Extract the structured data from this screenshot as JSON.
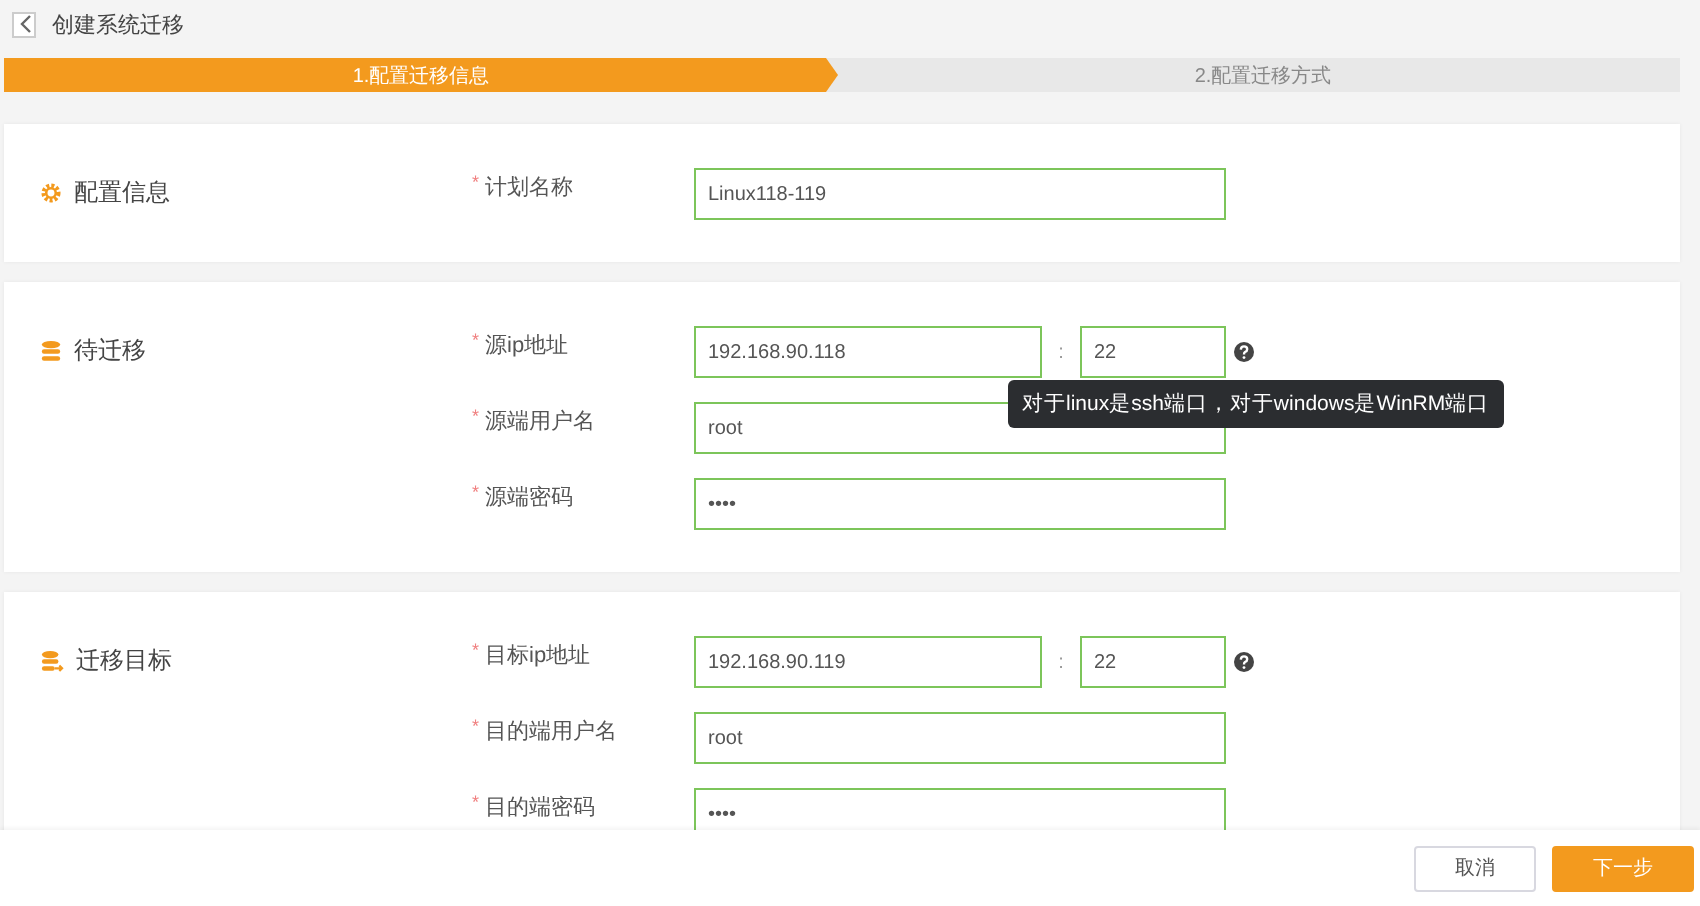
{
  "header": {
    "title": "创建系统迁移"
  },
  "steps": [
    {
      "label": "1.配置迁移信息",
      "selected": true
    },
    {
      "label": "2.配置迁移方式",
      "selected": false
    }
  ],
  "sections": [
    {
      "title": "配置信息",
      "fields": [
        {
          "kind": "text",
          "marker": "*",
          "label": "计划名称",
          "value": "Linux118-119"
        }
      ]
    },
    {
      "title": "待迁移",
      "fields": [
        {
          "kind": "host",
          "marker": "*",
          "label": "源ip地址",
          "value": "192.168.90.118",
          "separator": ":",
          "port": "22",
          "tooltip": "对于linux是ssh端口，对于windows是WinRM端口"
        },
        {
          "kind": "text",
          "marker": "*",
          "label": "源端用户名",
          "value": "root"
        },
        {
          "kind": "text",
          "marker": "*",
          "label": "源端密码",
          "value": "••••"
        }
      ]
    },
    {
      "title": "迁移目标",
      "fields": [
        {
          "kind": "host",
          "marker": "*",
          "label": "目标ip地址",
          "value": "192.168.90.119",
          "separator": ":",
          "port": "22"
        },
        {
          "kind": "text",
          "marker": "*",
          "label": "目的端用户名",
          "value": "root"
        },
        {
          "kind": "text",
          "marker": "*",
          "label": "目的端密码",
          "value": "••••"
        }
      ]
    }
  ],
  "buttons": [
    {
      "kind": "secondary",
      "label": "取消"
    },
    {
      "kind": "primary",
      "label": "下一步"
    }
  ]
}
